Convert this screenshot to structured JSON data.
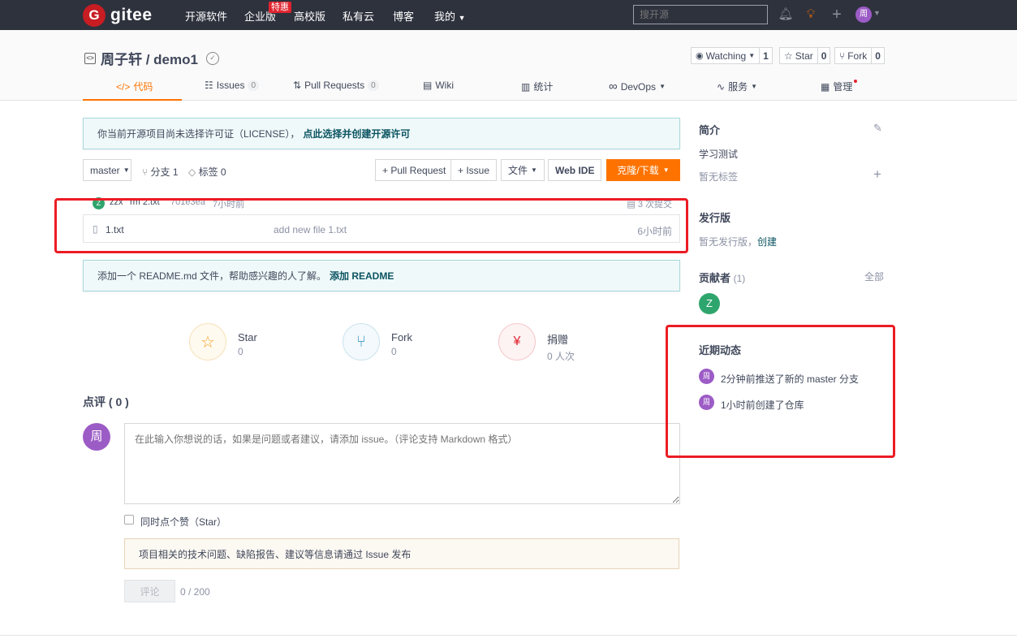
{
  "topbar": {
    "logo_text": "gitee",
    "nav": [
      "开源软件",
      "企业版",
      "高校版",
      "私有云",
      "博客",
      "我的"
    ],
    "hot_badge": "特惠",
    "search_placeholder": "搜开源",
    "avatar_text": "周"
  },
  "repo": {
    "title": "周子轩 / demo1",
    "watching_label": "Watching",
    "watching_count": "1",
    "star_label": "Star",
    "star_count": "0",
    "fork_label": "Fork",
    "fork_count": "0"
  },
  "tabs": [
    {
      "label": "代码",
      "badge": ""
    },
    {
      "label": "Issues",
      "badge": "0"
    },
    {
      "label": "Pull Requests",
      "badge": "0"
    },
    {
      "label": "Wiki",
      "badge": ""
    },
    {
      "label": "统计",
      "badge": ""
    },
    {
      "label": "DevOps",
      "badge": ""
    },
    {
      "label": "服务",
      "badge": ""
    },
    {
      "label": "管理",
      "badge": ""
    }
  ],
  "license_notice": {
    "text": "你当前开源项目尚未选择许可证（LICENSE），",
    "link": "点此选择并创建开源许可"
  },
  "toolbar": {
    "branch": "master",
    "branches": "分支 1",
    "tags": "标签 0",
    "pull_request": "+ Pull Request",
    "issue": "+ Issue",
    "file": "文件",
    "web_ide": "Web IDE",
    "clone": "克隆/下载"
  },
  "commit": {
    "avatar": "Z",
    "author": "zzx",
    "message": "rm 2.txt",
    "hash": "701e3ea",
    "time": "7小时前",
    "count": "3 次提交"
  },
  "files": [
    {
      "name": "1.txt",
      "message": "add new file 1.txt",
      "time": "6小时前"
    }
  ],
  "readme_notice": {
    "text": "添加一个 README.md 文件，帮助感兴趣的人了解。",
    "link": "添加 README"
  },
  "stats": [
    {
      "title": "Star",
      "value": "0",
      "color": "#f5a623"
    },
    {
      "title": "Fork",
      "value": "0",
      "color": "#4aa2c9"
    },
    {
      "title": "捐赠",
      "value": "0 人次",
      "color": "#e0242f"
    }
  ],
  "comments": {
    "title": "点评 ( 0 )",
    "avatar": "周",
    "placeholder": "在此输入你想说的话，如果是问题或者建议，请添加 issue。（评论支持 Markdown 格式）",
    "star_checkbox": "同时点个赞（Star）",
    "warning_text": "项目相关的技术问题、缺陷报告、建议等信息请通过 Issue 发布",
    "submit": "评论",
    "counter": "0 / 200"
  },
  "sidebar": {
    "intro_title": "简介",
    "intro_text": "学习测试",
    "no_tags": "暂无标签",
    "release_title": "发行版",
    "no_release": "暂无发行版，",
    "create": "创建",
    "contrib_title": "贡献者",
    "contrib_count": "(1)",
    "all": "全部",
    "contrib_avatar": "Z",
    "activity_title": "近期动态",
    "activities": [
      {
        "avatar": "周",
        "text": "2分钟前推送了新的 master 分支"
      },
      {
        "avatar": "周",
        "text": "1小时前创建了仓库"
      }
    ]
  }
}
